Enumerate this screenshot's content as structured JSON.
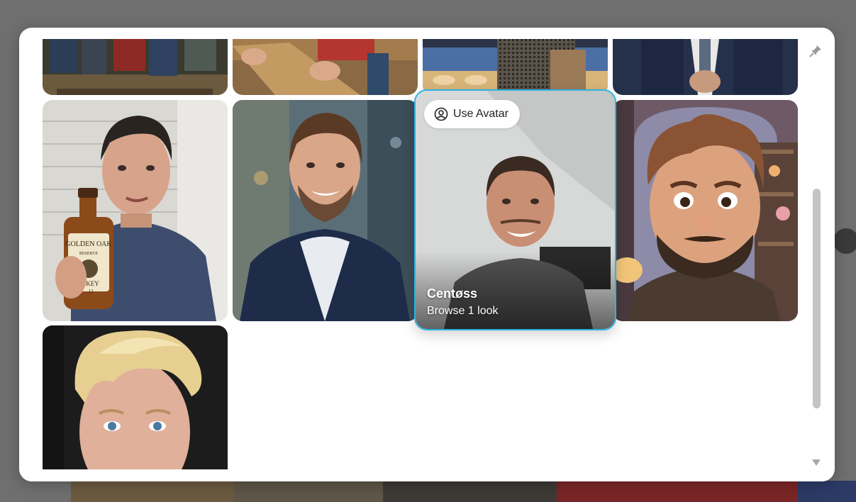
{
  "background": {
    "title_fragment": "",
    "brand_colors": {
      "accent": "#2bb3e3"
    }
  },
  "modal": {
    "close_icon": "pin-icon",
    "scroll_down_icon": "triangle-down-icon",
    "hover_card": {
      "action_label": "Use Avatar",
      "action_icon": "user-circle-icon",
      "name": "Centøss",
      "subtitle": "Browse 1 look"
    },
    "bottle_label": {
      "brand": "GOLDEN OAK",
      "line2": "RESERVE",
      "type": "SKEY",
      "age": "12"
    }
  }
}
